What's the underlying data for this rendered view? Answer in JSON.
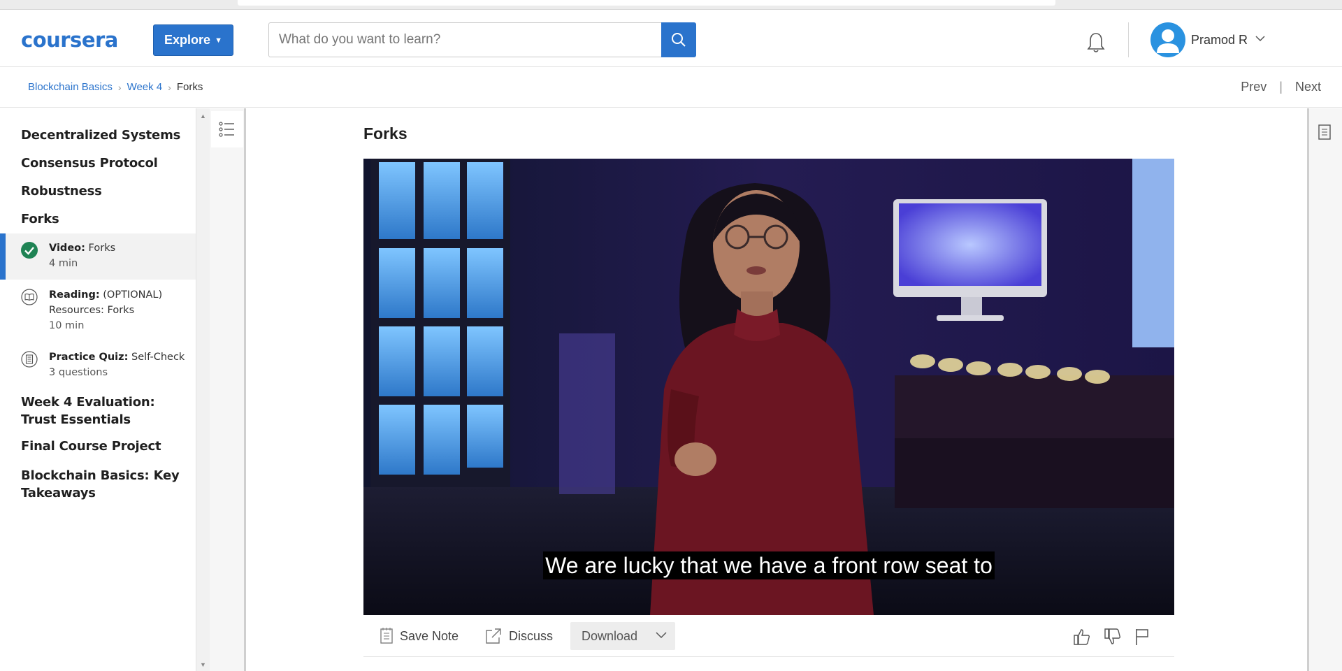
{
  "header": {
    "logo": "coursera",
    "explore_label": "Explore",
    "search_placeholder": "What do you want to learn?",
    "user_name": "Pramod R"
  },
  "breadcrumb": {
    "items": [
      "Blockchain Basics",
      "Week 4",
      "Forks"
    ],
    "prev": "Prev",
    "next": "Next"
  },
  "sidebar": {
    "lessons_top": [
      "Decentralized Systems",
      "Consensus Protocol",
      "Robustness",
      "Forks"
    ],
    "items": [
      {
        "type": "Video:",
        "title": "Forks",
        "meta": "4 min",
        "status": "completed"
      },
      {
        "type": "Reading:",
        "title": "(OPTIONAL) Resources: Forks",
        "meta": "10 min"
      },
      {
        "type": "Practice Quiz:",
        "title": "Self-Check",
        "meta": "3 questions"
      }
    ],
    "lessons_bottom": [
      "Week 4 Evaluation: Trust Essentials",
      "Final Course Project",
      "Blockchain Basics: Key Takeaways"
    ]
  },
  "main": {
    "title": "Forks",
    "caption": "We are lucky that we have a front row seat to",
    "actions": {
      "save_note": "Save Note",
      "discuss": "Discuss",
      "download": "Download"
    }
  },
  "colors": {
    "brand": "#2a73cc",
    "completed": "#1f8354"
  }
}
